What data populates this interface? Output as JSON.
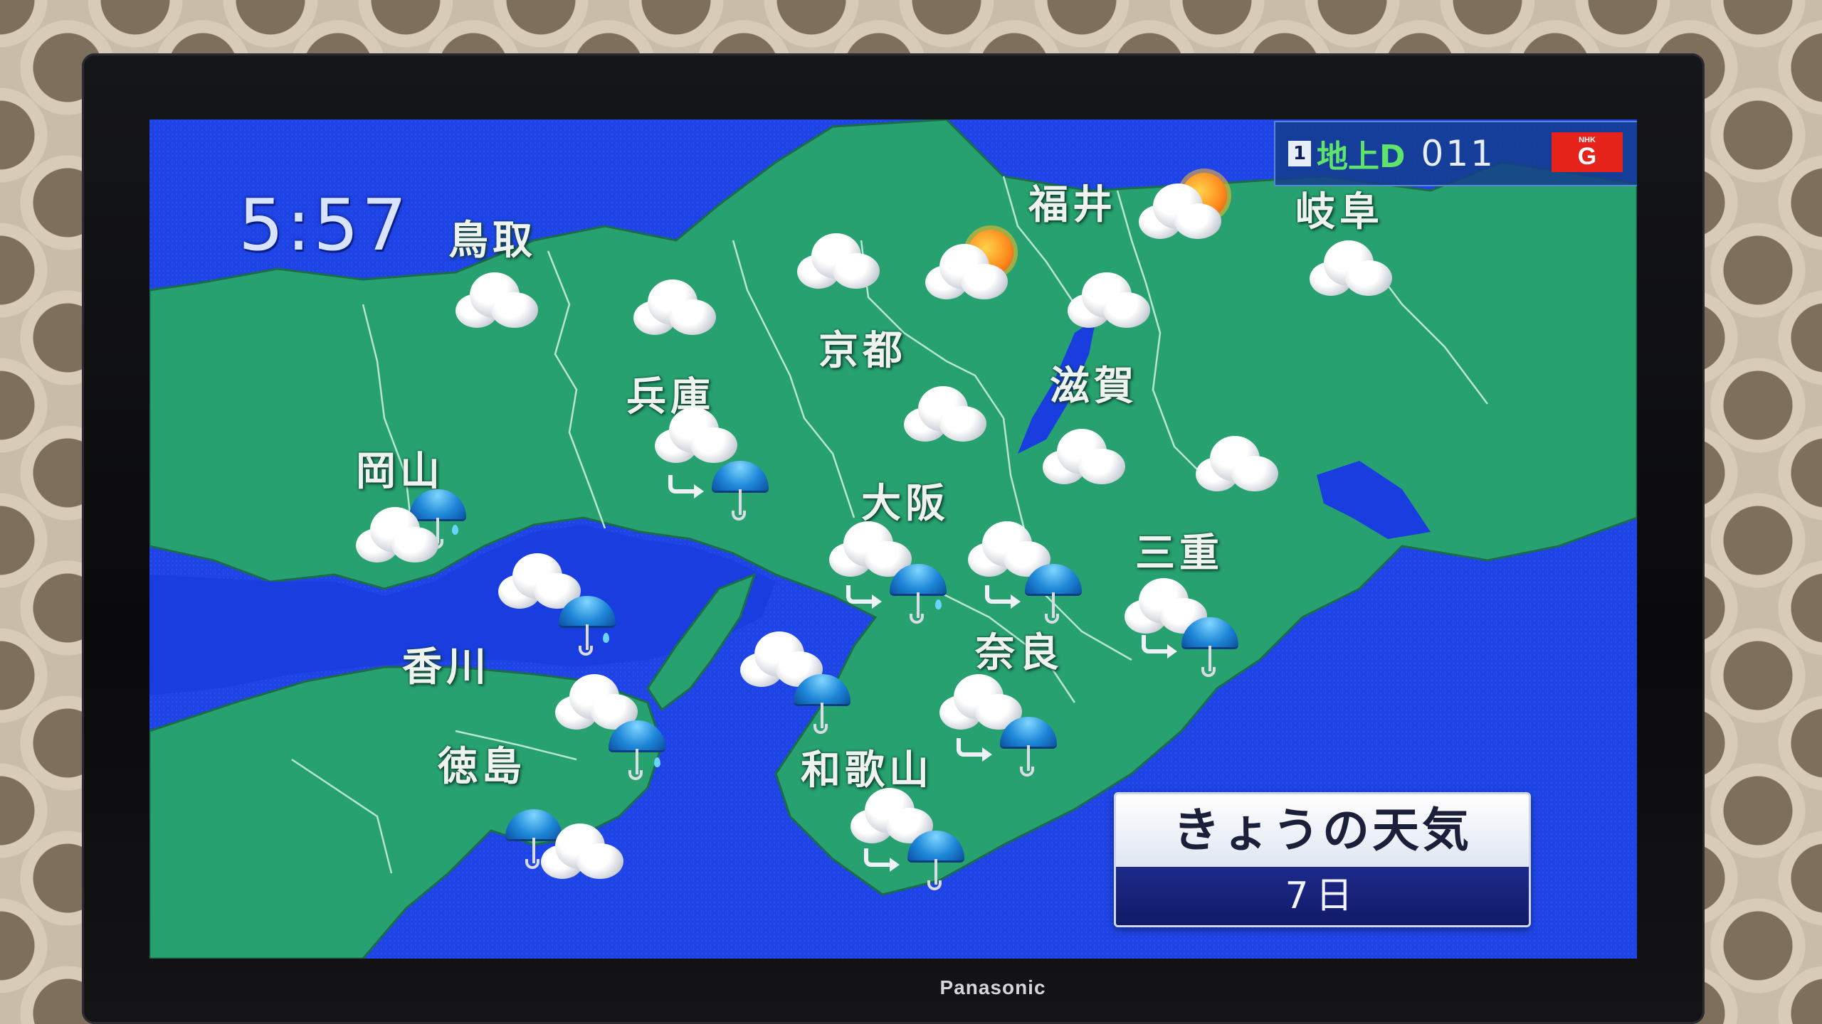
{
  "tv": {
    "brand": "Panasonic"
  },
  "broadcast": {
    "time": "5:57",
    "channel": {
      "index": "1",
      "type": "地上D",
      "number": "011",
      "network": "G",
      "network_top": "NHK"
    },
    "title": "きょうの天気",
    "date": "7日"
  },
  "prefectures": [
    {
      "name": "鳥取",
      "forecast": [
        "cloud-icon"
      ]
    },
    {
      "name": "福井",
      "forecast": [
        "cloud-icon",
        "sun-icon"
      ]
    },
    {
      "name": "岐阜",
      "forecast": [
        "cloud-icon"
      ]
    },
    {
      "name": "京都",
      "forecast": [
        "cloud-icon",
        "sun-icon"
      ]
    },
    {
      "name": "兵庫",
      "forecast": [
        "cloud-icon",
        "rain-icon"
      ]
    },
    {
      "name": "滋賀",
      "forecast": [
        "cloud-icon"
      ]
    },
    {
      "name": "岡山",
      "forecast": [
        "cloud-icon",
        "rain-icon"
      ]
    },
    {
      "name": "大阪",
      "forecast": [
        "cloud-icon",
        "rain-icon"
      ]
    },
    {
      "name": "三重",
      "forecast": [
        "cloud-icon",
        "rain-icon"
      ]
    },
    {
      "name": "香川",
      "forecast": [
        "cloud-icon",
        "rain-icon"
      ]
    },
    {
      "name": "奈良",
      "forecast": [
        "cloud-icon",
        "rain-icon"
      ]
    },
    {
      "name": "徳島",
      "forecast": [
        "rain-icon",
        "cloud-icon"
      ]
    },
    {
      "name": "和歌山",
      "forecast": [
        "cloud-icon",
        "rain-icon"
      ]
    }
  ],
  "colors": {
    "sea": "#1a3de0",
    "land": "#27a16f",
    "border": "#b9e6d3",
    "title_band": "#111a66",
    "network_logo": "#e6231a"
  }
}
